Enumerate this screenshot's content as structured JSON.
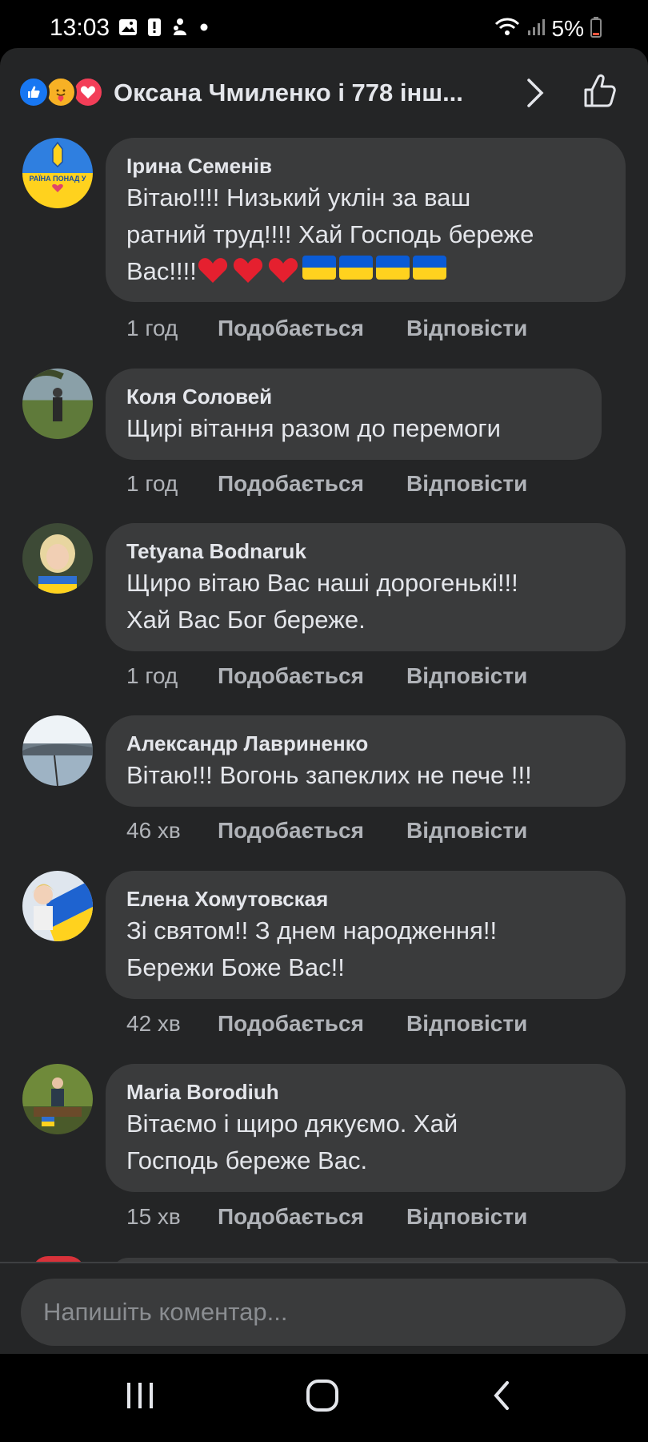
{
  "status_bar": {
    "time": "13:03",
    "battery": "5%"
  },
  "reactions": {
    "summary": "Оксана Чмиленко і 778 інш...",
    "icons": [
      "like-reaction-icon",
      "care-reaction-icon",
      "love-reaction-icon"
    ],
    "colors": {
      "like": "#1877f2",
      "care": "#f7b125",
      "love": "#f33e58"
    }
  },
  "comments": [
    {
      "name": "Ірина Семенів",
      "text": "Вітаю!!!! Низький уклін за ваш\nратний труд!!!! Хай Господь береже\nВас!!!!",
      "emoji": [
        "heart",
        "heart",
        "heart",
        "ukraine-flag",
        "ukraine-flag",
        "ukraine-flag",
        "ukraine-flag"
      ],
      "avatar_text": "РАЇНА ПОНАД У",
      "time": "1 год",
      "like_label": "Подобається",
      "reply_label": "Відповісти"
    },
    {
      "name": "Коля Соловей",
      "text": "Щирі вітання разом до перемоги",
      "time": "1 год",
      "like_label": "Подобається",
      "reply_label": "Відповісти"
    },
    {
      "name": "Tetyana Bodnaruk",
      "text": "Щиро вітаю Вас наші дорогенькі!!!\nХай Вас Бог береже.",
      "time": "1 год",
      "like_label": "Подобається",
      "reply_label": "Відповісти"
    },
    {
      "name": "Александр Лавриненко",
      "text": "Вітаю!!! Вогонь запеклих не пече !!!",
      "time": "46 хв",
      "like_label": "Подобається",
      "reply_label": "Відповісти"
    },
    {
      "name": "Елена Хомутовская",
      "text": "Зі святом!! З днем народження!!\nБережи Боже Вас!!",
      "time": "42 хв",
      "like_label": "Подобається",
      "reply_label": "Відповісти"
    },
    {
      "name": "Maria Borodiuh",
      "text": "Вітаємо і щиро дякуємо. Хай\nГосподь береже Вас.",
      "time": "15 хв",
      "like_label": "Подобається",
      "reply_label": "Відповісти"
    }
  ],
  "composer": {
    "placeholder": "Напишіть коментар..."
  },
  "nav": {
    "icons": [
      "recent-apps-icon",
      "home-icon",
      "back-icon"
    ]
  }
}
